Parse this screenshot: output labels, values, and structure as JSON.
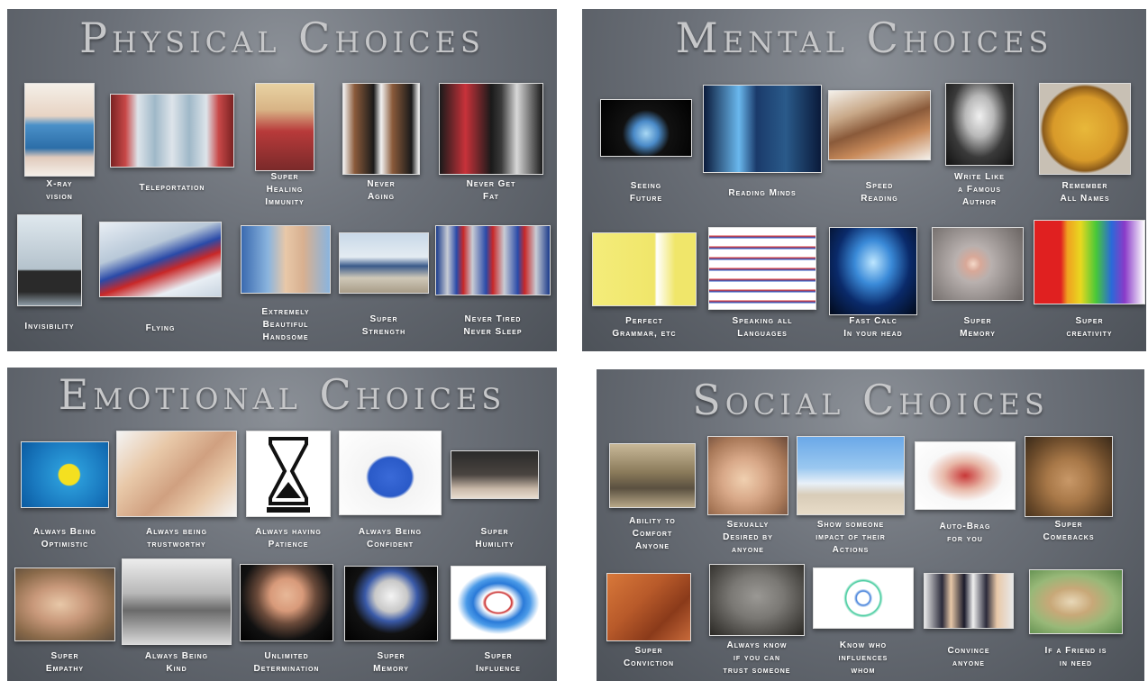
{
  "panels": [
    {
      "title": "Physical Choices",
      "items": [
        {
          "caption": "X-ray\nvision",
          "icon": "xray-scan-icon"
        },
        {
          "caption": "Teleportation",
          "icon": "teleporter-icon"
        },
        {
          "caption": "Super\nHealing\nImmunity",
          "icon": "healing-woman-icon"
        },
        {
          "caption": "Never\nAging",
          "icon": "before-after-faces-icon"
        },
        {
          "caption": "Never Get\nFat",
          "icon": "fit-women-icon"
        },
        {
          "caption": "Invisibility",
          "icon": "invisible-man-icon"
        },
        {
          "caption": "Flying",
          "icon": "flying-superman-icon"
        },
        {
          "caption": "Extremely\nBeautiful\nHandsome",
          "icon": "beautiful-face-icon"
        },
        {
          "caption": "Super\nStrength",
          "icon": "lifted-car-icon"
        },
        {
          "caption": "Never Tired\nNever Sleep",
          "icon": "energy-drink-cans-icon"
        }
      ]
    },
    {
      "title": "Mental Choices",
      "items": [
        {
          "caption": "Seeing\nFuture",
          "icon": "crystal-ball-icon"
        },
        {
          "caption": "Reading Minds",
          "icon": "mind-beam-icon"
        },
        {
          "caption": "Speed\nReading",
          "icon": "book-pile-icon"
        },
        {
          "caption": "Write Like\na Famous\nAuthor",
          "icon": "author-portrait-icon"
        },
        {
          "caption": "Remember\nAll Names",
          "icon": "name-badge-icon"
        },
        {
          "caption": "Perfect\nGrammar, etc",
          "icon": "grammar-card-icon"
        },
        {
          "caption": "Speaking all\nLanguages",
          "icon": "hello-tags-icon"
        },
        {
          "caption": "Fast Calc\nIn your head",
          "icon": "glowing-head-icon"
        },
        {
          "caption": "Super\nMemory",
          "icon": "neuron-icon"
        },
        {
          "caption": "Super\ncreativity",
          "icon": "color-bulbs-icon"
        }
      ]
    },
    {
      "title": "Emotional Choices",
      "items": [
        {
          "caption": "Always Being\nOptimistic",
          "icon": "smiley-balls-icon"
        },
        {
          "caption": "Always being\ntrustworthy",
          "icon": "open-hand-icon"
        },
        {
          "caption": "Always having\nPatience",
          "icon": "hourglass-icon"
        },
        {
          "caption": "Always Being\nConfident",
          "icon": "confident-cartoon-icon"
        },
        {
          "caption": "Super\nHumility",
          "icon": "kneeling-figure-icon"
        },
        {
          "caption": "Super\nEmpathy",
          "icon": "child-hug-icon"
        },
        {
          "caption": "Always Being\nKind",
          "icon": "dog-and-fawn-icon"
        },
        {
          "caption": "Unlimited\nDetermination",
          "icon": "determined-kid-icon"
        },
        {
          "caption": "Super\nMemory",
          "icon": "cartoon-poster-icon"
        },
        {
          "caption": "Super\nInfluence",
          "icon": "circle-of-people-icon"
        }
      ]
    },
    {
      "title": "Social Choices",
      "items": [
        {
          "caption": "Ability to\nComfort\nAnyone",
          "icon": "comforting-soldiers-icon"
        },
        {
          "caption": "Sexually\nDesired by\nanyone",
          "icon": "embrace-icon"
        },
        {
          "caption": "Show someone\nimpact of their\nActions",
          "icon": "mirror-reflection-icon"
        },
        {
          "caption": "Auto-Brag\nfor you",
          "icon": "brag-stamp-icon"
        },
        {
          "caption": "Super\nComebacks",
          "icon": "cat-meme-icon"
        },
        {
          "caption": "Super\nConviction",
          "icon": "rock-climber-icon"
        },
        {
          "caption": "Always know\nif you can\ntrust someone",
          "icon": "trust-stone-icon"
        },
        {
          "caption": "Know who\ninfluences\nwhom",
          "icon": "network-graph-icon"
        },
        {
          "caption": "Convince\nanyone",
          "icon": "business-meeting-icon"
        },
        {
          "caption": "If a Friend is\nin need",
          "icon": "box-robot-icon"
        }
      ]
    }
  ],
  "colors": {
    "panel_mid": "#6b7078",
    "title": "#c6c7c9",
    "caption": "#ffffff"
  }
}
